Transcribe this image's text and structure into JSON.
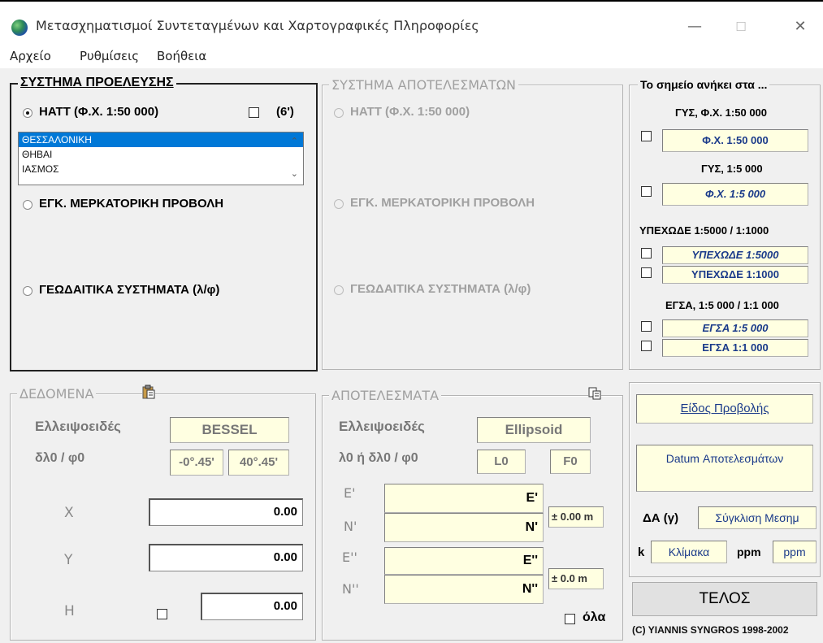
{
  "window": {
    "title": "Μετασχηματισμοί Συντεταγμένων και Χαρτογραφικές Πληροφορίες",
    "controls": {
      "minimize": "—",
      "maximize": "☐",
      "close": "✕"
    }
  },
  "menu": [
    "Αρχείο",
    "Ρυθμίσεις",
    "Βοήθεια"
  ],
  "source": {
    "title": "ΣΥΣΤΗΜΑ ΠΡΟΕΛΕΥΣΗΣ",
    "hatt_label": "HATT (Φ.Χ. 1:50 000)",
    "six_label": "(6')",
    "list_items": [
      "ΘΕΣΣΑΛΟΝΙΚΗ",
      "ΘΗΒΑΙ",
      "ΙΑΣΜΟΣ"
    ],
    "selected_item": "ΘΕΣΣΑΛΟΝΙΚΗ",
    "merc_label": "ΕΓΚ. ΜΕΡΚΑΤΟΡΙΚΗ ΠΡΟΒΟΛΗ",
    "geo_label": "ΓΕΩΔΑΙΤΙΚΑ ΣΥΣΤΗΜΑΤΑ (λ/φ)"
  },
  "results_system": {
    "title": "ΣΥΣΤΗΜΑ ΑΠΟΤΕΛΕΣΜΑΤΩΝ",
    "hatt_label": "HATT (Φ.Χ. 1:50 000)",
    "merc_label": "ΕΓΚ. ΜΕΡΚΑΤΟΡΙΚΗ ΠΡΟΒΟΛΗ",
    "geo_label": "ΓΕΩΔΑΙΤΙΚΑ ΣΥΣΤΗΜΑΤΑ (λ/φ)"
  },
  "maps": {
    "title": "Το σημείο ανήκει στα ...",
    "gys50_header": "ΓΥΣ, Φ.Χ. 1:50 000",
    "gys50_box": "Φ.Χ. 1:50 000",
    "gys5_header": "ΓΥΣ,  1:5 000",
    "gys5_box": "Φ.Χ. 1:5 000",
    "yp_header": "ΥΠΕΧΩΔΕ 1:5000 / 1:1000",
    "yp5000_box": "ΥΠΕΧΩΔΕ 1:5000",
    "yp1000_box": "ΥΠΕΧΩΔΕ 1:1000",
    "egsa_header": "ΕΓΣΑ, 1:5 000 / 1:1 000",
    "egsa5000_box": "ΕΓΣΑ 1:5 000",
    "egsa1000_box": "ΕΓΣΑ 1:1 000"
  },
  "data_panel": {
    "title": "ΔΕΔΟΜΕΝΑ",
    "ellipsoid_label": "Ελλειψοειδές",
    "ellipsoid_value": "BESSEL",
    "dl_label": "δλ0 / φ0",
    "dl_value": "-0°.45'",
    "phi_value": "40°.45'",
    "x_label": "X",
    "x_value": "0.00",
    "y_label": "Y",
    "y_value": "0.00",
    "h_label": "H",
    "h_value": "0.00"
  },
  "results_panel": {
    "title": "ΑΠΟΤΕΛΕΣΜΑΤΑ",
    "ellipsoid_label": "Ελλειψοειδές",
    "ellipsoid_value": "Ellipsoid",
    "l_label": "λ0 ή δλ0 / φ0",
    "l0_value": "L0",
    "f0_value": "F0",
    "e1_label": "E'",
    "e1_value": "E'",
    "n1_label": "N'",
    "n1_value": "N'",
    "acc1": "± 0.00 m",
    "e2_label": "E''",
    "e2_value": "E''",
    "n2_label": "N''",
    "n2_value": "N''",
    "acc2": "± 0.0 m",
    "all_label": "όλα"
  },
  "info_panel": {
    "projection": "Είδος Προβολής",
    "datum": "Datum Αποτελεσμάτων",
    "da_label": "ΔΑ (γ)",
    "da_value": "Σύγκλιση Μεσημ",
    "k_label": "k",
    "k_value": "Κλίμακα",
    "ppm_label": "ppm",
    "ppm_value": "ppm",
    "end_button": "ΤΕΛΟΣ",
    "copyright": "(C) YIANNIS SYNGROS 1998-2002"
  },
  "colors": {
    "field_bg": "#ffffe1",
    "selection": "#0078d7",
    "window_bg": "#f0f0f0"
  }
}
